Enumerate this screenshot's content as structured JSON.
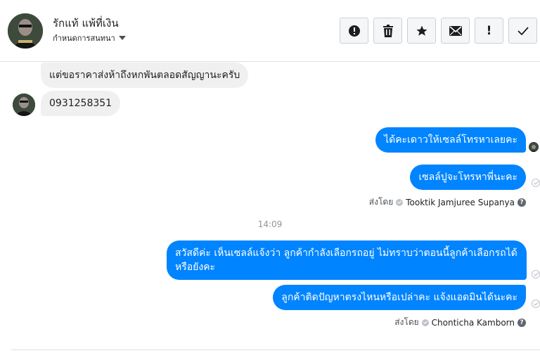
{
  "contact": {
    "name": "รักแท้ แพ้ที่เงิน",
    "assign_label": "กำหนดการสนทนา"
  },
  "toolbar": {
    "buttons": [
      {
        "name": "report",
        "icon": "alert-circle-icon"
      },
      {
        "name": "delete",
        "icon": "trash-icon"
      },
      {
        "name": "star",
        "icon": "star-icon"
      },
      {
        "name": "mark-unread",
        "icon": "envelope-icon"
      },
      {
        "name": "follow-up",
        "icon": "exclamation-icon",
        "label": "!"
      },
      {
        "name": "mark-done",
        "icon": "checkmark-icon"
      }
    ]
  },
  "messages": {
    "in_1": "แต่ขอราคาส่งห้าถึงหกพันตลอดสัญญานะครับ",
    "in_2": "0931258351",
    "out_1": "ได้คะเดาวให้เซลล์โทรหาเลยคะ",
    "out_2": "เซลล์ปูจะโทรหาพี่นะคะ",
    "sent_by_1_prefix": "ส่งโดย",
    "sent_by_1_name": "Tooktik Jamjuree Supanya",
    "timestamp": "14:09",
    "out_3": "สวัสดีค่ะ เห็นเซลล์แจ้งว่า ลูกค้ากำลังเลือกรถอยู่ ไม่ทราบว่าตอนนี้ลูกค้าเลือกรถได้หรือยังคะ",
    "out_4": "ลูกค้าติดปัญหาตรงไหนหรือเปล่าคะ แจ้งแอดมินได้นะคะ",
    "sent_by_2_prefix": "ส่งโดย",
    "sent_by_2_name": "Chonticha Kamborn"
  },
  "colors": {
    "outgoing_bubble": "#0084ff",
    "incoming_bubble": "#f1f0f0",
    "toolbar_button_bg": "#f5f6f7"
  }
}
